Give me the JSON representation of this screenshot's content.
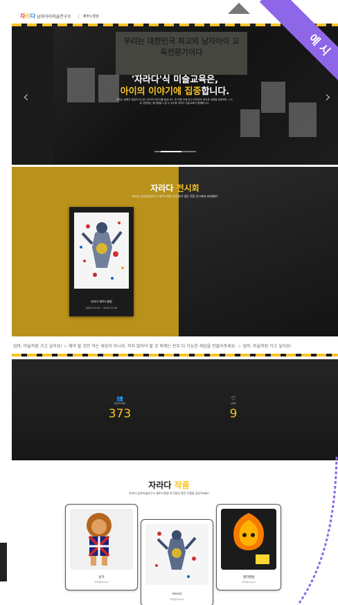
{
  "header": {
    "logo_k1": "자",
    "logo_k2": "라",
    "logo_k3": "다",
    "logo_rest": "남자아이미술연구소",
    "branch": "제주노형원"
  },
  "hero": {
    "board_text": "우리는 대한민국 최고의 남자아이 교육전문가이다",
    "title_line1": "'자라다'식 미술교육은,",
    "title_line2_highlight": "아이의 이야기에 집중",
    "title_line2_rest": "합니다.",
    "description": "우리는 정해진 정답이 아니라, 아이의 이야기를 듣습니다. 한 작품 안에 담긴 아이만의 생각과 감정을 존중하며, 스스로 표현하는 즐거움을 느낄 수 있도록 자라다 미술교육이 함께합니다.",
    "arrow_prev": "‹",
    "arrow_next": "›",
    "slide_progress": 0.5,
    "ribbon_label": "예 시"
  },
  "exhibition": {
    "title_white": "자라다 ",
    "title_highlight": "전시회",
    "subtitle": "자라다 남자미술연구소 제주노형원 친구들의 멋진 작품 전시회에 초대해요!",
    "card_name": "자라다 제주노형원",
    "card_date": "2023-12-04 ~ 2025-11-04"
  },
  "marquee": {
    "text": "엄마, 미술학원 가고 싶어요! ☆ 해야 할 것만 하는 세상이 아니라, 하지 말아야 할 것 외에는 전부 다 가능한 세상을 만들어주세요. ☆ 엄마, 미술학원 가고 싶어요!"
  },
  "stats": {
    "visitors": {
      "icon": "people-icon",
      "label": "VISITORS",
      "value": "373"
    },
    "likes": {
      "icon": "heart-icon",
      "label": "LIKE",
      "value": "9"
    }
  },
  "works": {
    "title_dark": "자라다 ",
    "title_highlight": "작품",
    "subtitle": "자라다 남자미술연구소 제주노형원 친구들의 멋진 작품을 감상하세요!",
    "items": [
      {
        "title": "동키",
        "sub": "#하랑2pxxx"
      },
      {
        "title": "Hero2",
        "sub": "#하랑2pxxx"
      },
      {
        "title": "엘리멘탈",
        "sub": "#하랑2pxxx"
      }
    ]
  },
  "colors": {
    "accent": "#f7c325",
    "ribbon": "#8e67e8",
    "dark": "#252525"
  }
}
